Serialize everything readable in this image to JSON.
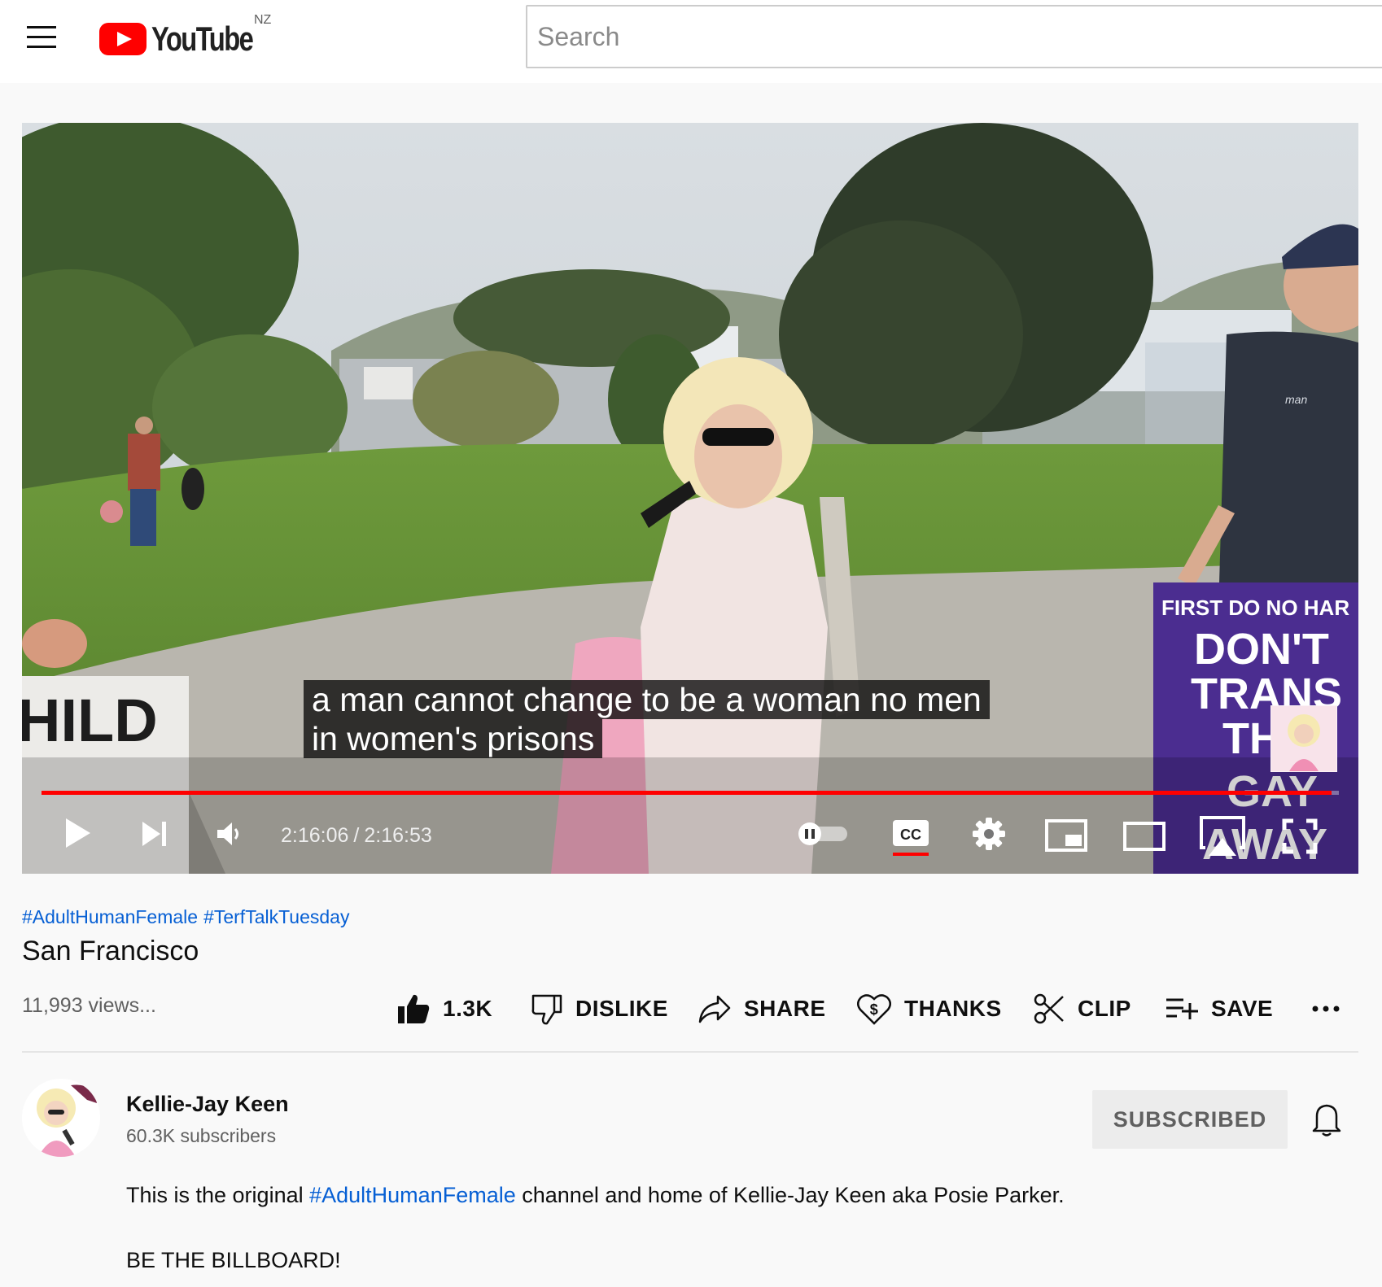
{
  "header": {
    "logo_text": "YouTube",
    "region": "NZ",
    "search_placeholder": "Search"
  },
  "player": {
    "caption_line1": "a man cannot change to be a woman no men",
    "caption_line2": "in women's prisons",
    "current_time": "2:16:06",
    "duration": "2:16:53",
    "progress_fraction": 0.9943,
    "scene_text": {
      "sign_left": "HILD",
      "sign_right_top": "FIRST DO NO HAR",
      "sign_right_main": [
        "DON'T",
        "TRANS",
        "THE",
        "GAY",
        "AWAY"
      ],
      "shirt_text": "man"
    }
  },
  "video": {
    "hashtags": [
      "#AdultHumanFemale",
      "#TerfTalkTuesday"
    ],
    "title": "San Francisco",
    "views": "11,993 views..."
  },
  "actions": {
    "like_count": "1.3K",
    "dislike_label": "DISLIKE",
    "share_label": "SHARE",
    "thanks_label": "THANKS",
    "clip_label": "CLIP",
    "save_label": "SAVE"
  },
  "channel": {
    "name": "Kellie-Jay Keen",
    "subscribers": "60.3K subscribers",
    "subscribe_label": "SUBSCRIBED"
  },
  "description": {
    "line1_before": "This is the original ",
    "line1_link": "#AdultHumanFemale",
    "line1_after": " channel and home of Kellie-Jay Keen aka Posie Parker.",
    "line2": "BE THE BILLBOARD!"
  },
  "colors": {
    "brand_red": "#ff0000",
    "link_blue": "#065fd4",
    "sign_purple": "#4b2d90",
    "grass": "#5f8a33"
  }
}
